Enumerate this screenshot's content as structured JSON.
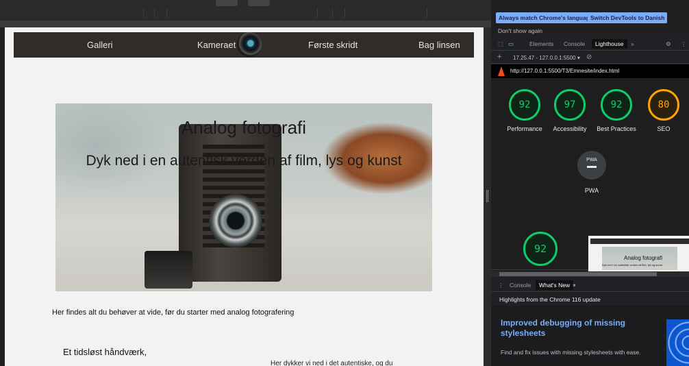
{
  "page": {
    "nav": {
      "galleri": "Galleri",
      "kameraet": "Kameraet",
      "forste_skridt": "Første skridt",
      "bag_linsen": "Bag linsen"
    },
    "hero": {
      "title": "Analog fotografi",
      "subtitle": "Dyk ned i en autentisk verden af film, lys og kunst"
    },
    "intro": "Her findes alt du behøver at vide, før du starter med analog fotografering",
    "section_title": "Et tidsløst håndværk,",
    "cut_text": "Her dykker vi ned i det autentiske, og du"
  },
  "devtools": {
    "infobar": {
      "btn_match": "Always match Chrome's language",
      "btn_switch": "Switch DevTools to Danish",
      "dont_show": "Don't show again"
    },
    "tabs": {
      "elements": "Elements",
      "console": "Console",
      "lighthouse": "Lighthouse",
      "more": "»"
    },
    "toolbar": {
      "plus": "+",
      "report": "17.25.47 - 127.0.0.1:5500 ▾",
      "clear": "⊘"
    },
    "url": "http://127.0.0.1:5500/T3/Emnesite/index.html",
    "scores": [
      {
        "value": "92",
        "label": "Performance",
        "color": "#0cce6b"
      },
      {
        "value": "97",
        "label": "Accessibility",
        "color": "#0cce6b"
      },
      {
        "value": "92",
        "label": "Best Practices",
        "color": "#0cce6b"
      },
      {
        "value": "80",
        "label": "SEO",
        "color": "#ffa400"
      }
    ],
    "pwa": {
      "badge": "PWA",
      "label": "PWA"
    },
    "big_score": "92",
    "thumb": {
      "title": "Analog fotografi",
      "sub": "Dyk ned i en autentisk verden af film, lys og kunst"
    },
    "drawer": {
      "console": "Console",
      "whats_new": "What's New",
      "close": "×",
      "highlights": "Highlights from the Chrome 116 update",
      "article_title": "Improved debugging of missing stylesheets",
      "article_desc": "Find and fix issues with missing stylesheets with ease."
    }
  }
}
